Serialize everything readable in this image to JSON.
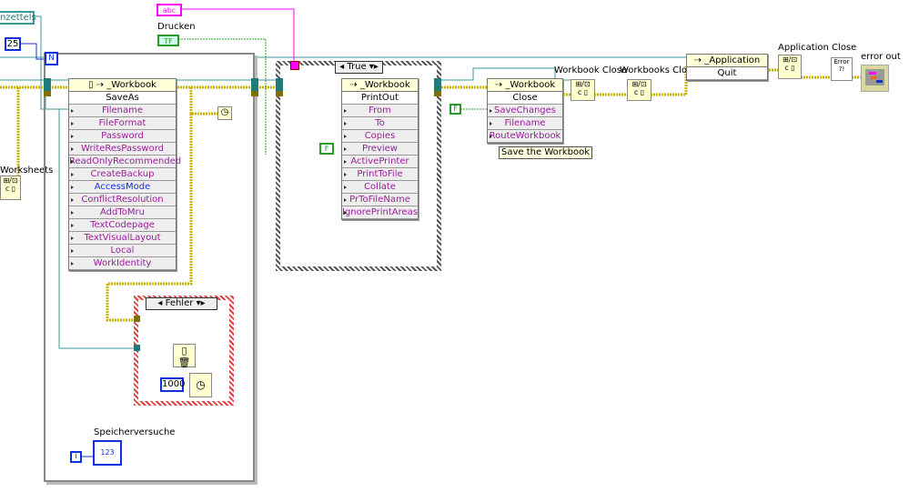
{
  "controls": {
    "string_control": "abc",
    "drucken_label": "Drucken",
    "drucken_value": "TF",
    "blatt_label": "nzettels",
    "loop_count": "25",
    "worksheets_label": "Worksheets"
  },
  "loop": {
    "n_label": "N",
    "i_label": "i",
    "indicator_label": "Speicherversuche",
    "indicator_value": "123"
  },
  "saveas_node": {
    "class": "_Workbook",
    "method": "SaveAs",
    "params": [
      "Filename",
      "FileFormat",
      "Password",
      "WriteResPassword",
      "ReadOnlyRecommended",
      "CreateBackup",
      "AccessMode",
      "ConflictResolution",
      "AddToMru",
      "TextCodepage",
      "TextVisualLayout",
      "Local",
      "WorkIdentity"
    ],
    "blue_params": [
      "AccessMode"
    ]
  },
  "error_case": {
    "selector": "Fehler",
    "wait_ms": "1000"
  },
  "print_case": {
    "selector": "True",
    "false_const": "F"
  },
  "printout_node": {
    "class": "_Workbook",
    "method": "PrintOut",
    "params": [
      "From",
      "To",
      "Copies",
      "Preview",
      "ActivePrinter",
      "PrintToFile",
      "Collate",
      "PrToFileName",
      "IgnorePrintAreas"
    ]
  },
  "close_node": {
    "class": "_Workbook",
    "method": "Close",
    "params": [
      "SaveChanges",
      "Filename",
      "RouteWorkbook"
    ],
    "false_const": "F",
    "comment": "Save the Workbook"
  },
  "close_refs": [
    {
      "label": "Workbook Close"
    },
    {
      "label": "Workbooks Close"
    },
    {
      "label": "Application Close"
    }
  ],
  "quit_node": {
    "class": "_Application",
    "method": "Quit"
  },
  "error_out": {
    "label": "error out",
    "handler": "Error ?!"
  },
  "colors": {
    "refnum_wire": "#c8b400",
    "error_wire": "#0a8a8a",
    "string_wire": "#ff00ff",
    "bool_wire": "#2a9a2a",
    "int_wire": "#1030e0",
    "error_case": "#e04040"
  }
}
